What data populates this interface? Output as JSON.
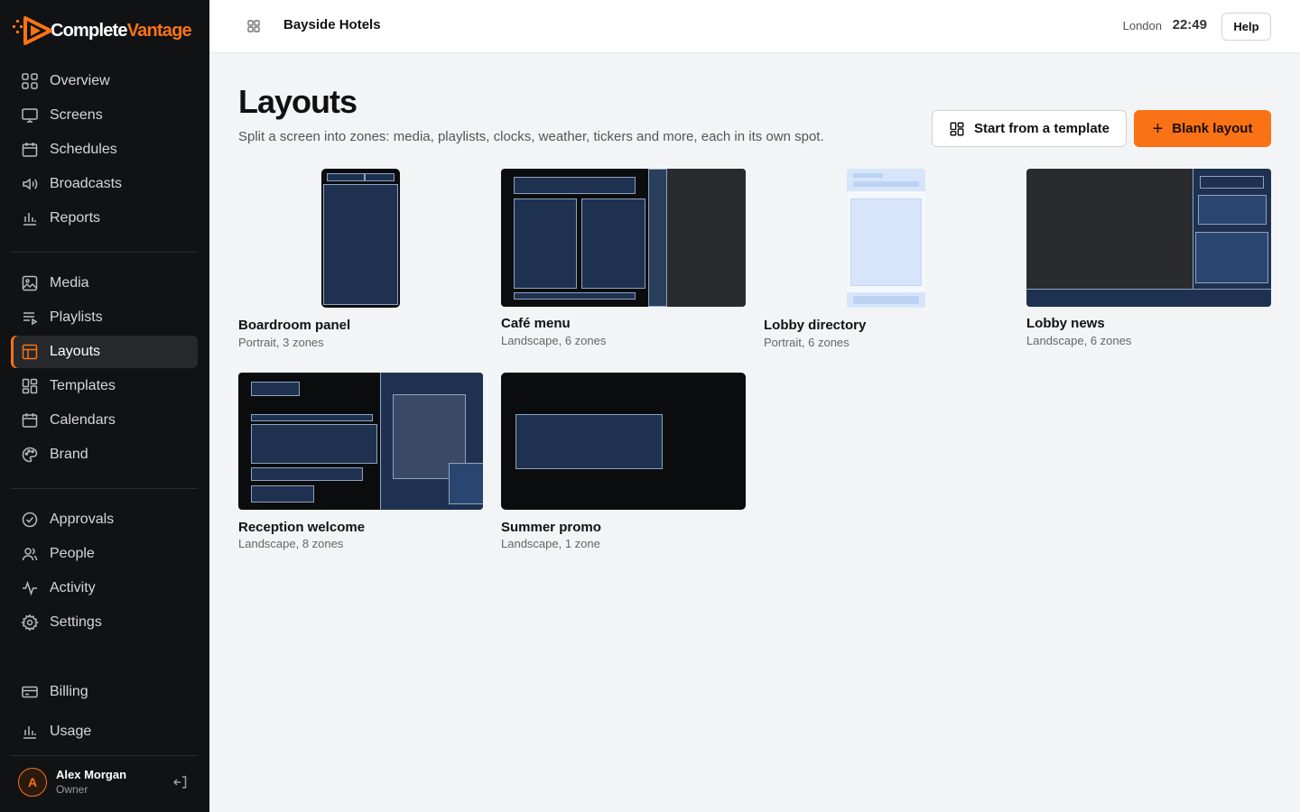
{
  "brand": {
    "name_part1": "Complete",
    "name_part2": "Vantage",
    "accent": "#f97316"
  },
  "sidebar": {
    "group1": [
      {
        "label": "Overview",
        "icon": "grid-icon"
      },
      {
        "label": "Screens",
        "icon": "monitor-icon"
      },
      {
        "label": "Schedules",
        "icon": "calendar-icon"
      },
      {
        "label": "Broadcasts",
        "icon": "speaker-icon"
      },
      {
        "label": "Reports",
        "icon": "bar-chart-icon"
      }
    ],
    "group2": [
      {
        "label": "Media",
        "icon": "image-icon"
      },
      {
        "label": "Playlists",
        "icon": "playlist-icon"
      },
      {
        "label": "Layouts",
        "icon": "layout-icon",
        "active": true
      },
      {
        "label": "Templates",
        "icon": "templates-icon"
      },
      {
        "label": "Calendars",
        "icon": "calendar-icon"
      },
      {
        "label": "Brand",
        "icon": "palette-icon"
      }
    ],
    "group3": [
      {
        "label": "Approvals",
        "icon": "check-circle-icon"
      },
      {
        "label": "People",
        "icon": "users-icon"
      },
      {
        "label": "Activity",
        "icon": "activity-icon"
      },
      {
        "label": "Settings",
        "icon": "gear-icon"
      }
    ],
    "group4": [
      {
        "label": "Billing",
        "icon": "card-icon"
      },
      {
        "label": "Usage",
        "icon": "bar-chart-icon"
      }
    ],
    "user": {
      "initial": "A",
      "name": "Alex Morgan",
      "role": "Owner"
    }
  },
  "topbar": {
    "org": "Bayside Hotels",
    "city": "London",
    "time": "22:49",
    "help": "Help"
  },
  "main": {
    "title": "Layouts",
    "subtitle": "Split a screen into zones: media, playlists, clocks, weather, tickers and more, each in its own spot.",
    "btn_template": "Start from a template",
    "btn_blank": "Blank layout",
    "cards": [
      {
        "title": "Boardroom panel",
        "meta": "Portrait, 3 zones"
      },
      {
        "title": "Café menu",
        "meta": "Landscape, 6 zones"
      },
      {
        "title": "Lobby directory",
        "meta": "Portrait, 6 zones"
      },
      {
        "title": "Lobby news",
        "meta": "Landscape, 6 zones"
      },
      {
        "title": "Reception welcome",
        "meta": "Landscape, 8 zones"
      },
      {
        "title": "Summer promo",
        "meta": "Landscape, 1 zone"
      }
    ]
  }
}
